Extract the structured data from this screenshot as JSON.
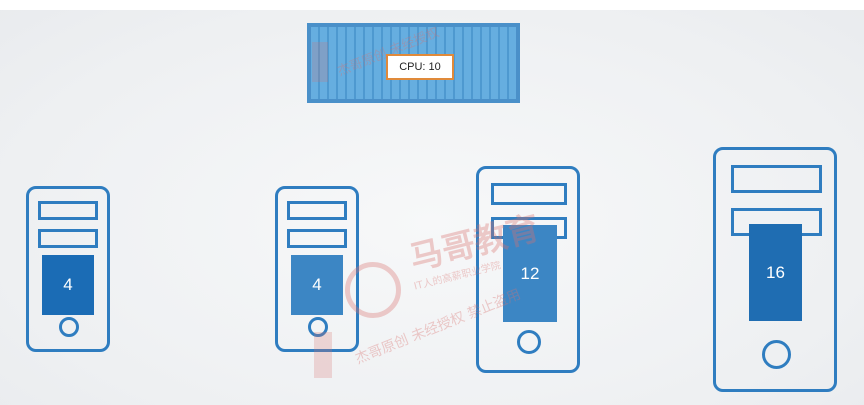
{
  "pod": {
    "label": "CPU: 10"
  },
  "nodes": [
    {
      "capacity": "4"
    },
    {
      "capacity": "4"
    },
    {
      "capacity": "12"
    },
    {
      "capacity": "16"
    }
  ],
  "watermark": {
    "brand": "马哥教育",
    "tagline": "IT人的高薪职业学院",
    "notice_1": "杰哥原创 未经授权 禁止盗用",
    "notice_2": "杰哥原创 未经授权"
  },
  "colors": {
    "node_border": "#2f7dc0",
    "capacity_block_small": "#1b6cb5",
    "capacity_block_mid": "#3c86c4",
    "capacity_block_large": "#1f6db2",
    "pod_fill": "#66aee0",
    "pod_label_border": "#e08a3a"
  }
}
